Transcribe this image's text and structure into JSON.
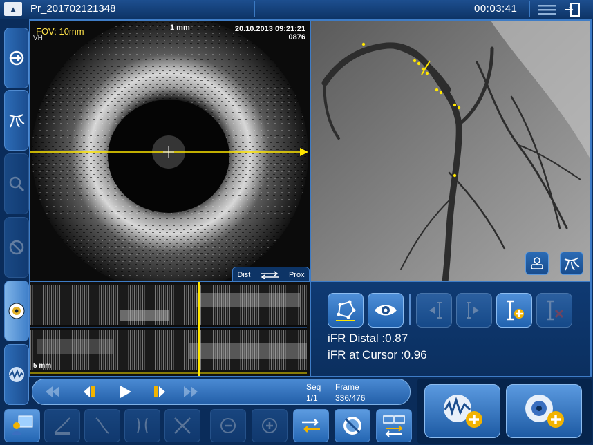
{
  "titlebar": {
    "logo_glyph": "▲",
    "patient_id": "Pr_201702121348",
    "elapsed_time": "00:03:41",
    "menu_icon": "hamburger-menu-icon",
    "exit_icon": "exit-door-icon"
  },
  "sidebar": {
    "items": [
      {
        "name": "pullback-mode-icon",
        "state": "normal"
      },
      {
        "name": "angio-coregistration-icon",
        "state": "normal"
      },
      {
        "name": "measure-zoom-icon",
        "state": "disabled"
      },
      {
        "name": "compare-icon",
        "state": "disabled"
      },
      {
        "name": "ivus-mode-icon",
        "state": "active"
      },
      {
        "name": "pressure-waveform-icon",
        "state": "normal"
      }
    ]
  },
  "ivus": {
    "fov_label": "FOV: 10mm",
    "mode_label": "VH",
    "scale_label": "1 mm",
    "date_time": "20.10.2013 09:21:21",
    "frame_code": "0876",
    "dist_label": "Dist",
    "prox_label": "Prox",
    "cursor_color": "#ffe600"
  },
  "longview": {
    "scale_label": "5 mm"
  },
  "angio": {
    "marker_color": "#ffe600"
  },
  "controls": {
    "ifr_distal": "iFR Distal :0.87",
    "ifr_cursor": "iFR at Cursor :0.96",
    "buttons": [
      {
        "name": "contour-tool-icon",
        "enabled": true
      },
      {
        "name": "eye-visibility-icon",
        "enabled": true
      },
      {
        "name": "move-marker-left-icon",
        "enabled": false
      },
      {
        "name": "move-marker-right-icon",
        "enabled": false
      },
      {
        "name": "add-marker-icon",
        "enabled": true
      },
      {
        "name": "delete-marker-icon",
        "enabled": false
      }
    ]
  },
  "playback": {
    "seq_label": "Seq",
    "frame_label": "Frame",
    "seq_value": "1/1",
    "frame_value": "336/476"
  },
  "toolbar": {
    "items": [
      {
        "name": "review-station-icon",
        "enabled": true
      },
      {
        "name": "ruler-measure-icon",
        "enabled": false
      },
      {
        "name": "split-screen-icon",
        "enabled": false
      },
      {
        "name": "vessel-branch-icon",
        "enabled": false
      },
      {
        "name": "cross-cut-icon",
        "enabled": false
      },
      {
        "name": "zoom-out-icon",
        "enabled": false
      },
      {
        "name": "zoom-in-icon",
        "enabled": false
      },
      {
        "name": "sync-rotate-icon",
        "enabled": true
      },
      {
        "name": "no-compare-icon",
        "enabled": true
      },
      {
        "name": "transfer-monitor-icon",
        "enabled": true
      }
    ]
  },
  "add_buttons": {
    "add_pressure": "add-pressure-recording-icon",
    "add_ivus": "add-ivus-recording-icon"
  }
}
